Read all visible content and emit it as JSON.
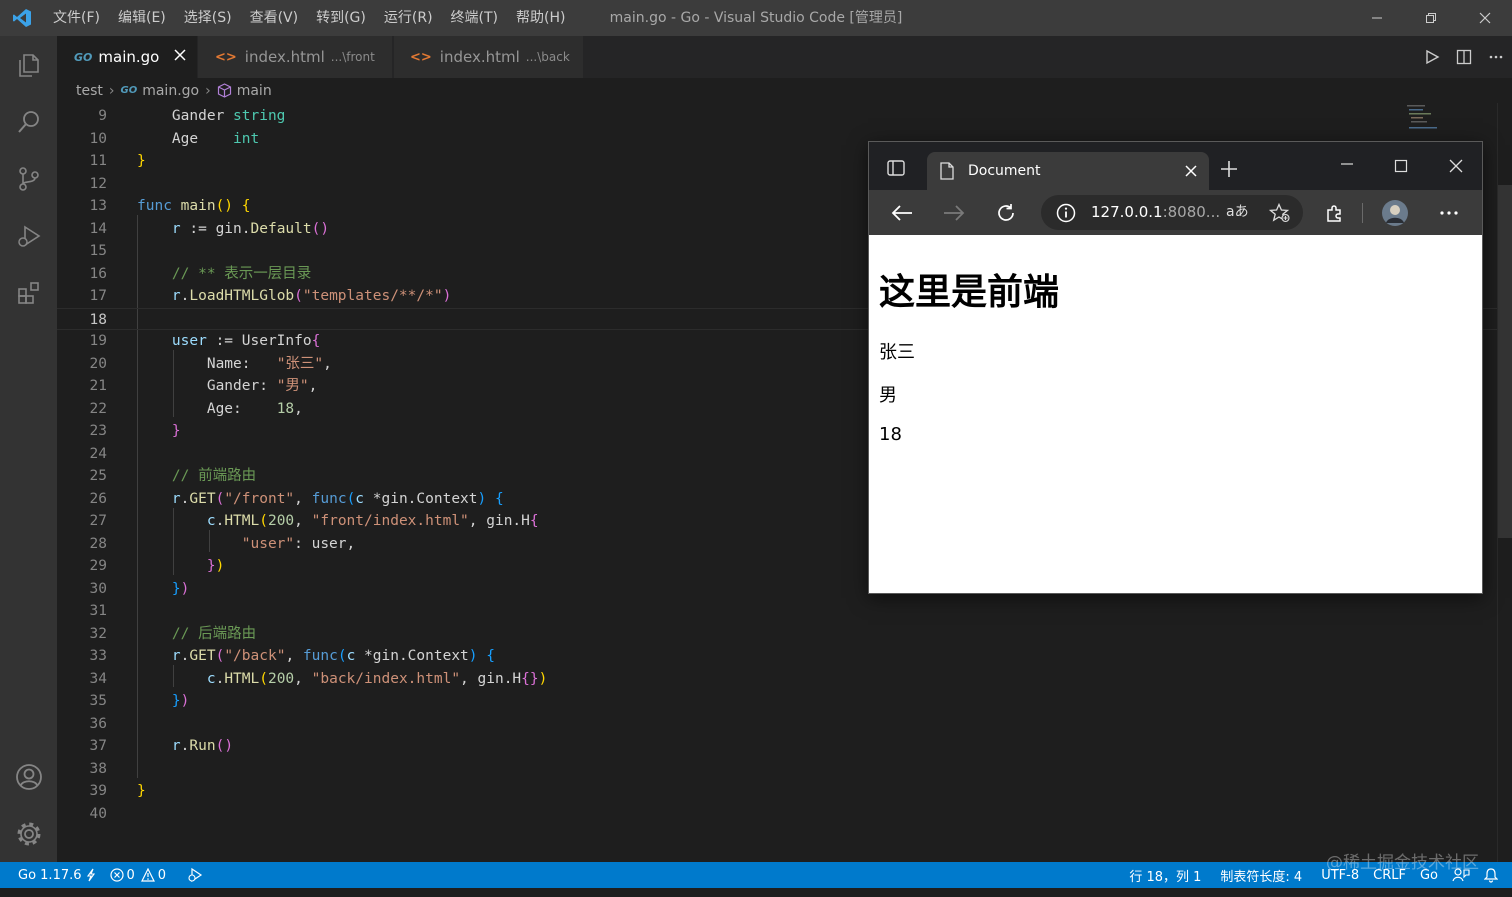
{
  "titlebar": {
    "menus": [
      "文件(F)",
      "编辑(E)",
      "选择(S)",
      "查看(V)",
      "转到(G)",
      "运行(R)",
      "终端(T)",
      "帮助(H)"
    ],
    "title": "main.go - Go - Visual Studio Code [管理员]"
  },
  "tabs": [
    {
      "label": "main.go",
      "icon": "go-file-icon",
      "active": true
    },
    {
      "label": "index.html",
      "sub": "...\\front",
      "icon": "html-file-icon",
      "active": false
    },
    {
      "label": "index.html",
      "sub": "...\\back",
      "icon": "html-file-icon",
      "active": false
    }
  ],
  "breadcrumb": {
    "folder": "test",
    "file": "main.go",
    "symbol": "main"
  },
  "editor": {
    "current_line": 18,
    "lines": [
      {
        "n": "9",
        "text": "    Gander string"
      },
      {
        "n": "10",
        "text": "    Age    int"
      },
      {
        "n": "11",
        "text": "}"
      },
      {
        "n": "12",
        "text": ""
      },
      {
        "n": "13",
        "text": "func main() {"
      },
      {
        "n": "14",
        "text": "    r := gin.Default()"
      },
      {
        "n": "15",
        "text": ""
      },
      {
        "n": "16",
        "text": "    // ** 表示一层目录"
      },
      {
        "n": "17",
        "text": "    r.LoadHTMLGlob(\"templates/**/*\")"
      },
      {
        "n": "18",
        "text": ""
      },
      {
        "n": "19",
        "text": "    user := UserInfo{"
      },
      {
        "n": "20",
        "text": "        Name:   \"张三\","
      },
      {
        "n": "21",
        "text": "        Gander: \"男\","
      },
      {
        "n": "22",
        "text": "        Age:    18,"
      },
      {
        "n": "23",
        "text": "    }"
      },
      {
        "n": "24",
        "text": ""
      },
      {
        "n": "25",
        "text": "    // 前端路由"
      },
      {
        "n": "26",
        "text": "    r.GET(\"/front\", func(c *gin.Context) {"
      },
      {
        "n": "27",
        "text": "        c.HTML(200, \"front/index.html\", gin.H{"
      },
      {
        "n": "28",
        "text": "            \"user\": user,"
      },
      {
        "n": "29",
        "text": "        })"
      },
      {
        "n": "30",
        "text": "    })"
      },
      {
        "n": "31",
        "text": ""
      },
      {
        "n": "32",
        "text": "    // 后端路由"
      },
      {
        "n": "33",
        "text": "    r.GET(\"/back\", func(c *gin.Context) {"
      },
      {
        "n": "34",
        "text": "        c.HTML(200, \"back/index.html\", gin.H{})"
      },
      {
        "n": "35",
        "text": "    })"
      },
      {
        "n": "36",
        "text": ""
      },
      {
        "n": "37",
        "text": "    r.Run()"
      },
      {
        "n": "38",
        "text": ""
      },
      {
        "n": "39",
        "text": "}"
      },
      {
        "n": "40",
        "text": ""
      }
    ]
  },
  "browser": {
    "tab_title": "Document",
    "url_host": "127.0.0.1",
    "url_rest": ":8080...",
    "read_aloud": "aあ",
    "heading": "这里是前端",
    "paragraphs": [
      "张三",
      "男",
      "18"
    ]
  },
  "statusbar": {
    "go_version": "Go 1.17.6",
    "errors": "0",
    "warnings": "0",
    "position": "行 18，列 1",
    "tab_size": "制表符长度: 4",
    "encoding": "UTF-8",
    "eol": "CRLF",
    "language": "Go"
  },
  "watermark": "@稀土掘金技术社区",
  "colors": {
    "titlebar": "#3c3c3c",
    "activitybar": "#333333",
    "editor_bg": "#1e1e1e",
    "statusbar": "#007acc",
    "keyword": "#569cd6",
    "string": "#ce9178",
    "comment": "#6a9955"
  }
}
